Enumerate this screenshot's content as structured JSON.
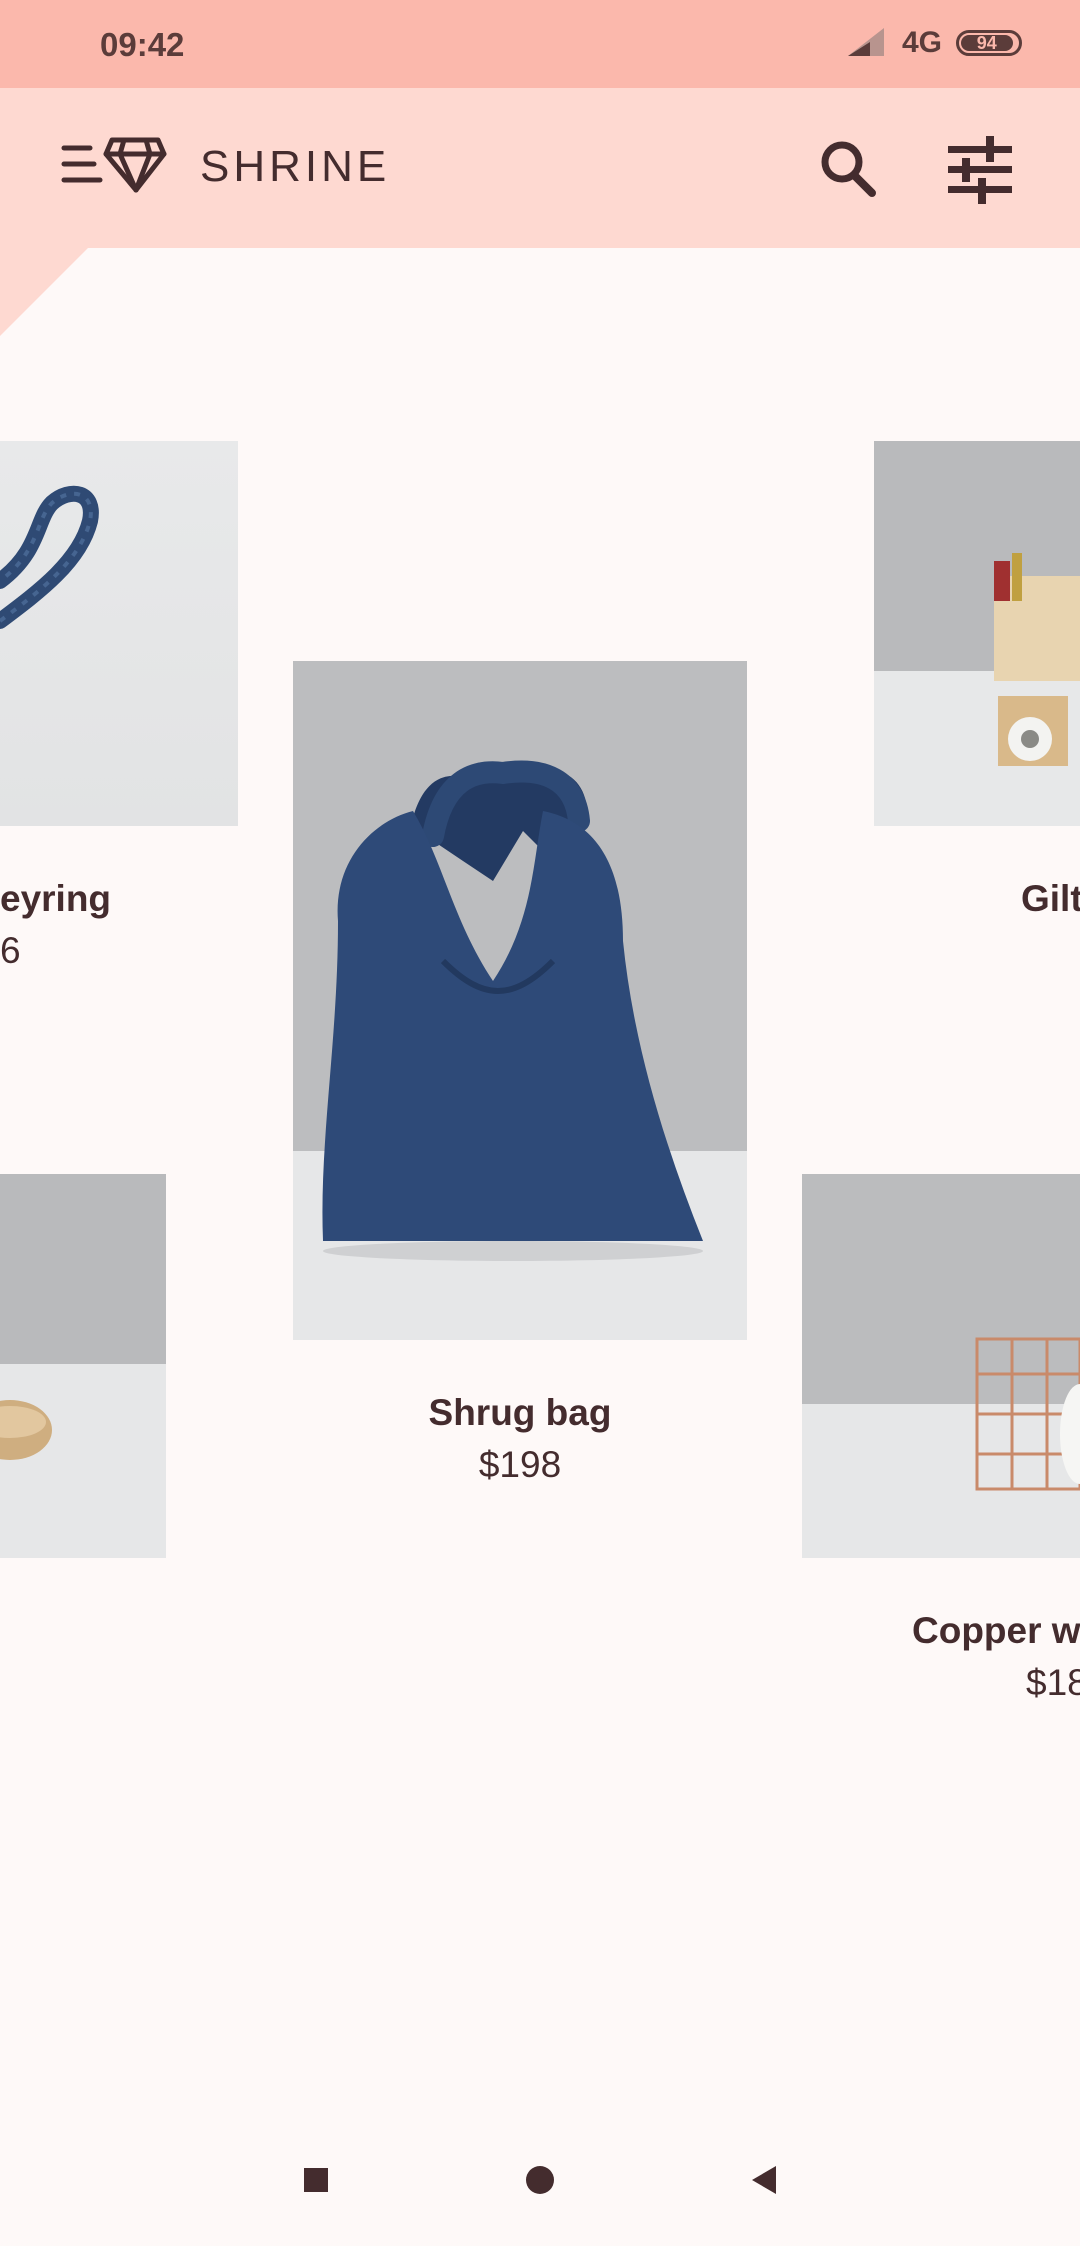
{
  "status_bar": {
    "time": "09:42",
    "network": "4G",
    "battery": "94",
    "icons": [
      "signal-icon",
      "battery-icon"
    ]
  },
  "app_bar": {
    "title": "SHRINE",
    "icons": [
      "menu-icon",
      "diamond-logo-icon",
      "search-icon",
      "tune-icon"
    ]
  },
  "products": [
    {
      "name": "Keyring",
      "name_visible": "eyring",
      "price_visible": "6"
    },
    {
      "name": "Shrug bag",
      "price": "$198"
    },
    {
      "name_visible": "Gilt"
    },
    {
      "name_visible": "Copper w",
      "price_visible": "$18"
    }
  ],
  "nav_bar": {
    "icons": [
      "recents-square-icon",
      "home-circle-icon",
      "back-triangle-icon"
    ]
  },
  "colors": {
    "status_bar": "#fbb8ac",
    "app_bar": "#fed9d1",
    "background": "#fef9f8",
    "text": "#442c2e",
    "bag_blue": "#2e4a78"
  }
}
